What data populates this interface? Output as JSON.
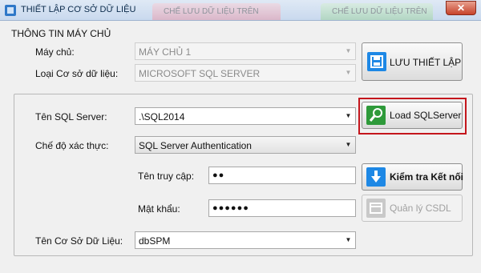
{
  "window": {
    "title": "THIẾT LẬP CƠ SỞ DỮ LIỆU",
    "close": "✕"
  },
  "background_tabs": [
    "CHẾ LƯU DỮ LIỆU TRÊN",
    "CHẾ LƯU DỮ LIỆU TRÊN"
  ],
  "server_group": {
    "title": "THÔNG TIN MÁY CHỦ",
    "server_label": "Máy chủ:",
    "server_value": "MÁY CHỦ 1",
    "db_type_label": "Loại Cơ sở dữ liệu:",
    "db_type_value": "MICROSOFT SQL SERVER",
    "save_button": "LƯU THIẾT LẬP"
  },
  "connection": {
    "sql_server_label": "Tên SQL Server:",
    "sql_server_value": ".\\SQL2014",
    "load_button": "Load SQLServer",
    "auth_label": "Chế độ xác thực:",
    "auth_value": "SQL Server Authentication",
    "username_label": "Tên truy cập:",
    "username_value": "●●",
    "check_button": "Kiểm tra Kết nối",
    "password_label": "Mật khẩu:",
    "password_value": "●●●●●●",
    "manage_button": "Quản lý CSDL",
    "database_label": "Tên Cơ Sở Dữ Liệu:",
    "database_value": "dbSPM"
  },
  "icons": {
    "save": "save-icon",
    "load": "search-icon",
    "check": "download-arrow-icon",
    "manage": "database-icon"
  },
  "colors": {
    "accent_blue": "#1e88e5",
    "accent_green": "#2e9a3a",
    "highlight_red": "#c4161c"
  }
}
